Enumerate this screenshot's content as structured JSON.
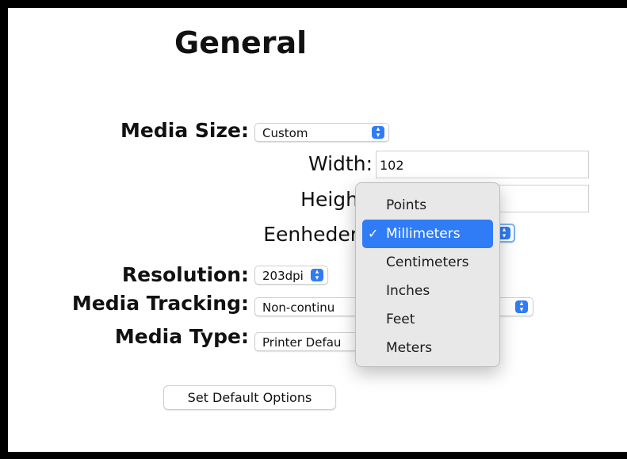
{
  "title": "General",
  "media_size": {
    "label": "Media Size:",
    "value": "Custom"
  },
  "width": {
    "label": "Width:",
    "value": "102"
  },
  "height": {
    "label": "Heigh",
    "value": ""
  },
  "units": {
    "label": "Eenheder",
    "value": ""
  },
  "resolution": {
    "label": "Resolution:",
    "value": "203dpi"
  },
  "media_tracking": {
    "label": "Media Tracking:",
    "value": "Non-continu"
  },
  "media_type": {
    "label": "Media Type:",
    "value": "Printer Defau"
  },
  "set_default_button": "Set Default Options",
  "units_menu": {
    "check_glyph": "✓",
    "items": [
      "Points",
      "Millimeters",
      "Centimeters",
      "Inches",
      "Feet",
      "Meters"
    ],
    "selected": "Millimeters"
  },
  "colors": {
    "accent": "#2f7cf6",
    "background": "#ffffff",
    "border": "#000000"
  }
}
